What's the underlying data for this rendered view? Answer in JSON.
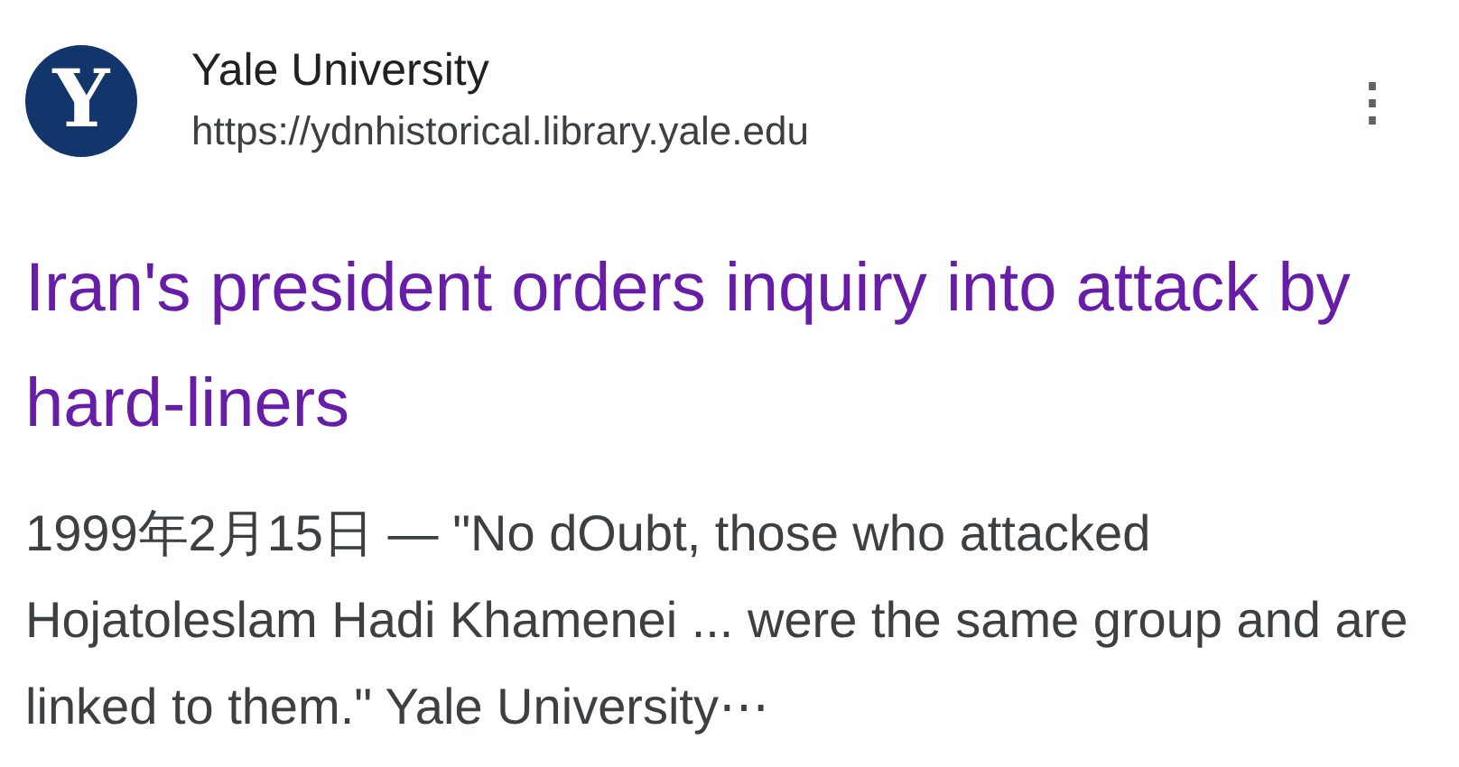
{
  "source": {
    "logo_letter": "Y",
    "name": "Yale University",
    "url": "https://ydnhistorical.library.yale.edu",
    "menu_icon": "⋮"
  },
  "result": {
    "title": "Iran's president orders inquiry into attack by hard-liners",
    "visited": true,
    "snippet": "1999年2月15日 — \"No dOubt, those who attacked Hojatoleslam Hadi Khamenei ... were the same group and are linked to them.\" Yale University⋯"
  }
}
